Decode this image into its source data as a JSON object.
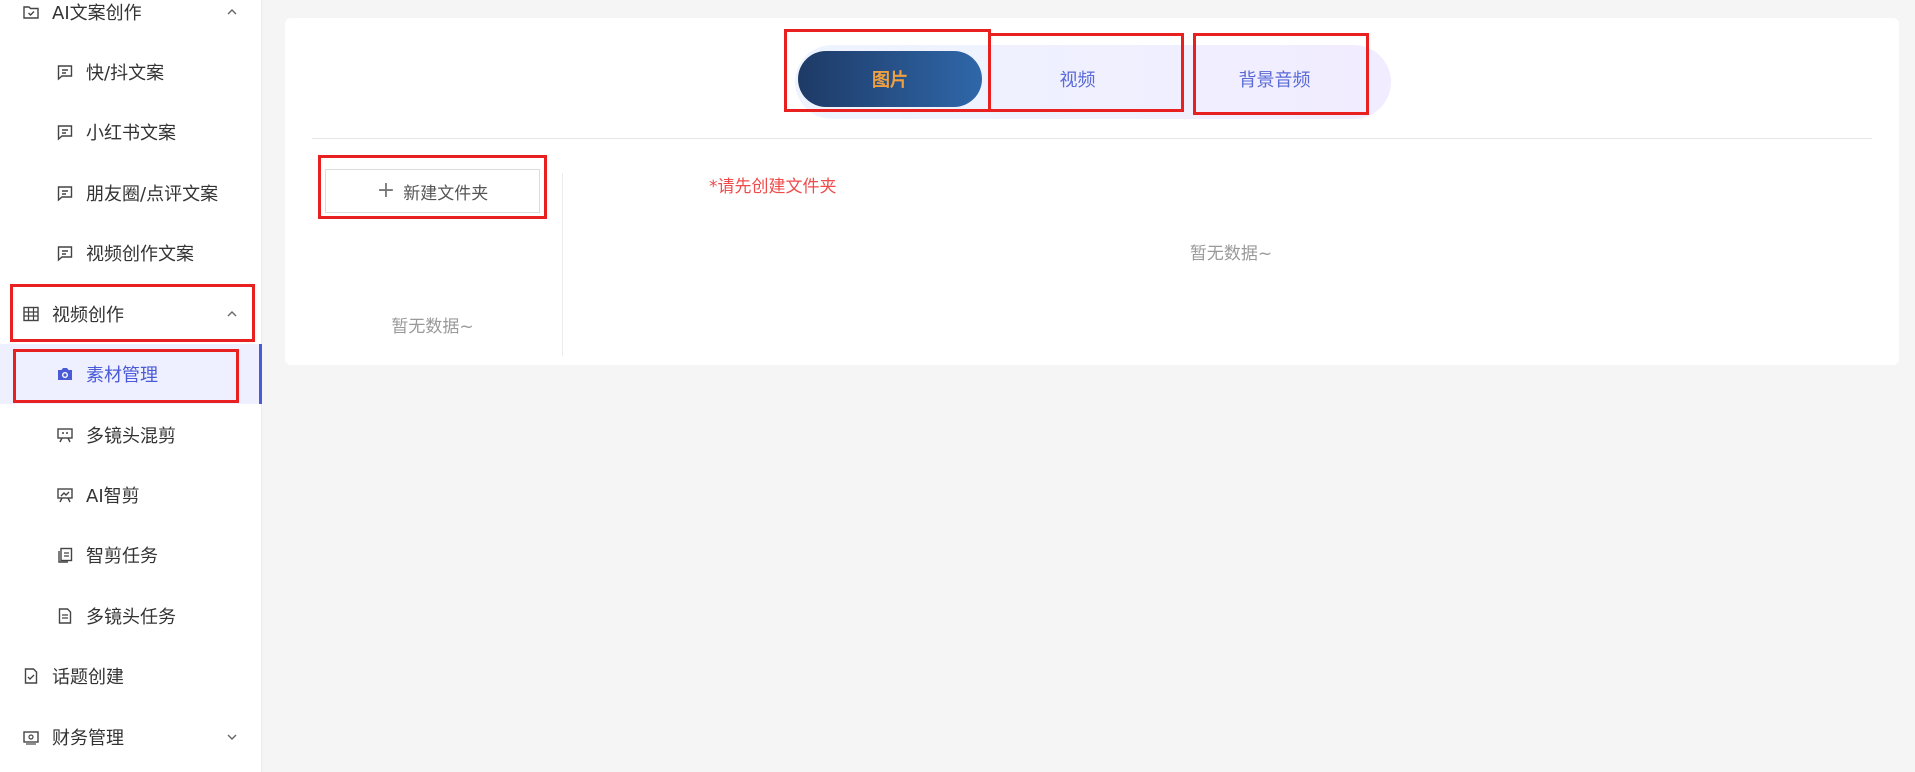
{
  "sidebar": {
    "items": [
      {
        "label": "AI文案创作",
        "icon": "folder-check-icon",
        "expanded": true
      },
      {
        "label": "快/抖文案",
        "icon": "message-square-icon"
      },
      {
        "label": "小红书文案",
        "icon": "message-square-icon"
      },
      {
        "label": "朋友圈/点评文案",
        "icon": "message-square-icon"
      },
      {
        "label": "视频创作文案",
        "icon": "message-square-icon"
      },
      {
        "label": "视频创作",
        "icon": "film-grid-icon",
        "expanded": true
      },
      {
        "label": "素材管理",
        "icon": "camera-icon",
        "active": true
      },
      {
        "label": "多镜头混剪",
        "icon": "presentation-icon"
      },
      {
        "label": "AI智剪",
        "icon": "chart-board-icon"
      },
      {
        "label": "智剪任务",
        "icon": "copy-doc-icon"
      },
      {
        "label": "多镜头任务",
        "icon": "document-icon"
      },
      {
        "label": "话题创建",
        "icon": "file-check-icon"
      },
      {
        "label": "财务管理",
        "icon": "wallet-icon",
        "expanded": false
      }
    ]
  },
  "tabs": {
    "items": [
      {
        "label": "图片",
        "selected": true
      },
      {
        "label": "视频",
        "selected": false
      },
      {
        "label": "背景音频",
        "selected": false
      }
    ]
  },
  "folders": {
    "new_button_label": "新建文件夹",
    "empty_text": "暂无数据~"
  },
  "content": {
    "hint": "*请先创建文件夹",
    "empty_text": "暂无数据~"
  },
  "colors": {
    "accent": "#4a5ad8",
    "highlight_box": "#e8201f",
    "tab_selected_text": "#f0a040",
    "hint_text": "#f04b4b"
  }
}
